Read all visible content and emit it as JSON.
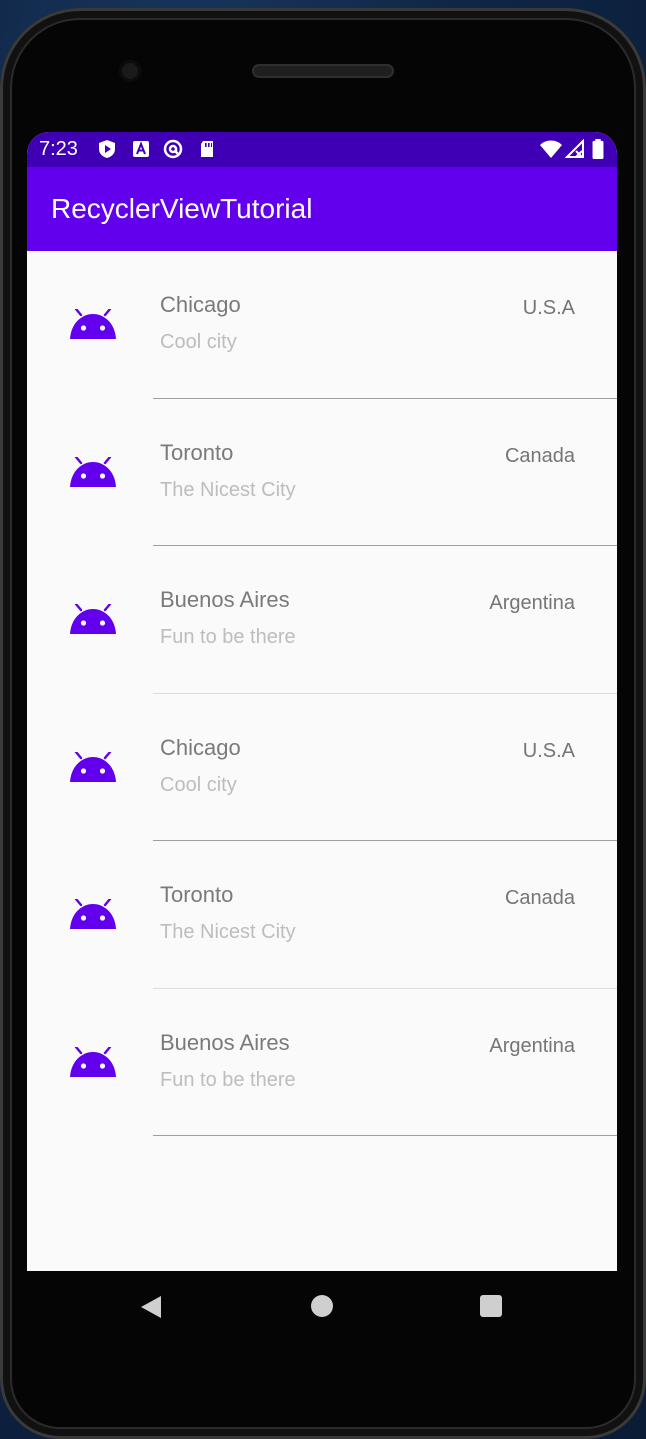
{
  "status_bar": {
    "time": "7:23",
    "left_icons": [
      "shield-icon",
      "a-icon",
      "at-icon",
      "sdcard-icon"
    ],
    "right_icons": [
      "wifi-icon",
      "signal-icon",
      "battery-icon"
    ]
  },
  "app_bar": {
    "title": "RecyclerViewTutorial"
  },
  "colors": {
    "primary": "#6200ee",
    "primary_dark": "#3f00b5",
    "icon": "#6200ee"
  },
  "list": {
    "items": [
      {
        "city": "Chicago",
        "description": "Cool city",
        "country": "U.S.A",
        "icon": "android-icon"
      },
      {
        "city": "Toronto",
        "description": "The Nicest City",
        "country": "Canada",
        "icon": "android-icon"
      },
      {
        "city": "Buenos Aires",
        "description": "Fun to be there",
        "country": "Argentina",
        "icon": "android-icon"
      },
      {
        "city": "Chicago",
        "description": "Cool city",
        "country": "U.S.A",
        "icon": "android-icon"
      },
      {
        "city": "Toronto",
        "description": "The Nicest City",
        "country": "Canada",
        "icon": "android-icon"
      },
      {
        "city": "Buenos Aires",
        "description": "Fun to be there",
        "country": "Argentina",
        "icon": "android-icon"
      }
    ]
  },
  "nav_bar": {
    "buttons": [
      "back-icon",
      "home-icon",
      "recents-icon"
    ]
  }
}
